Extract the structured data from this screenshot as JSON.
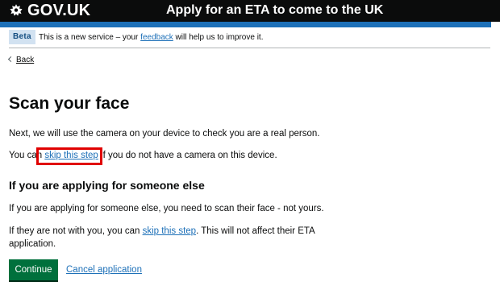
{
  "colors": {
    "header_bg": "#0b0c0c",
    "accent_blue": "#1d70b8",
    "link": "#1d70b8",
    "beta_tag_bg": "#d2e2f1",
    "beta_tag_text": "#144e81",
    "button_green": "#00703c",
    "highlight_red": "#e00000",
    "text": "#0b0c0c"
  },
  "header": {
    "logo_icon": "crown-icon",
    "logo_text": "GOV.UK",
    "service_name": "Apply for an ETA to come to the UK"
  },
  "phase_banner": {
    "tag": "Beta",
    "text_before": "This is a new service – your ",
    "feedback_link": "feedback",
    "text_after": " will help us to improve it."
  },
  "back_link": {
    "icon": "chevron-left-icon",
    "label": "Back"
  },
  "main": {
    "title": "Scan your face",
    "p1": "Next, we will use the camera on your device to check you are a real person.",
    "p2_before": "You can ",
    "p2_link": "skip this step",
    "p2_after": " if you do not have a camera on this device.",
    "subheading": "If you are applying for someone else",
    "p3": "If you are applying for someone else, you need to scan their face - not yours.",
    "p4_before": "If they are not with you, you can ",
    "p4_link": "skip this step",
    "p4_after": ". This will not affect their ETA application."
  },
  "actions": {
    "continue_label": "Continue",
    "cancel_label": "Cancel application"
  }
}
